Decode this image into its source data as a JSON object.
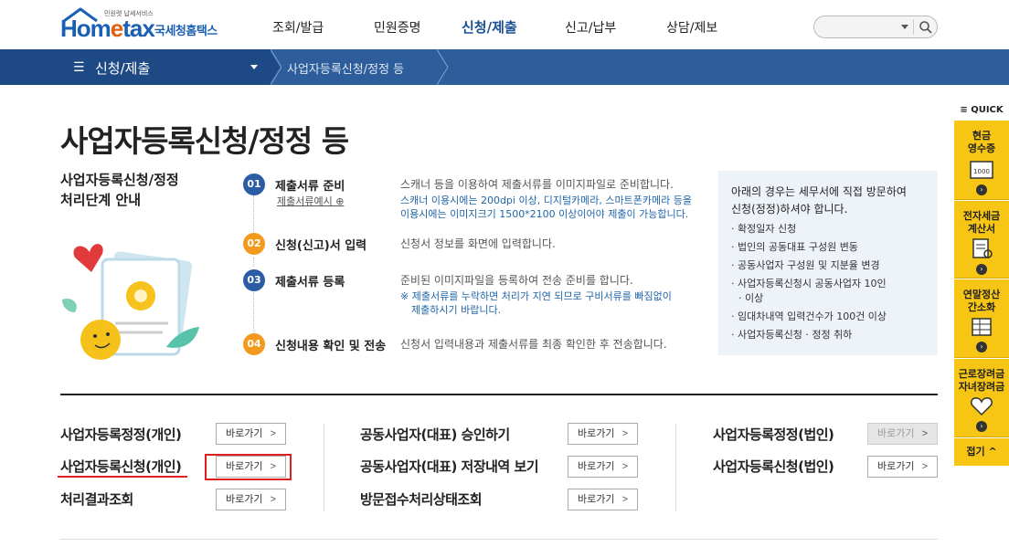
{
  "header": {
    "logo_en_1": "Hom",
    "logo_en_e": "e",
    "logo_en_2": "tax",
    "logo_small": "민원렛 납세서비스",
    "logo_ko": "국세청홈택스",
    "menu": [
      {
        "label": "조회/발급"
      },
      {
        "label": "민원증명"
      },
      {
        "label": "신청/제출",
        "active": true
      },
      {
        "label": "신고/납부"
      },
      {
        "label": "상담/제보"
      }
    ]
  },
  "navbar": {
    "current": "신청/제출",
    "breadcrumb": "사업자등록신청/정정 등"
  },
  "page": {
    "title": "사업자등록신청/정정 등",
    "guide_title_1": "사업자등록신청/정정",
    "guide_title_2": "처리단계 안내"
  },
  "steps": [
    {
      "num": "01",
      "title": "제출서류 준비",
      "sub": "제출서류예시",
      "desc": "스캐너 등을 이용하여 제출서류를 이미지파일로 준비합니다.",
      "note1": "스캐너 이용시에는 200dpi 이상, 디지털카메라, 스마트폰카메라 등을",
      "note2": "이용시에는 이미지크기 1500*2100 이상이어야 제출이 가능합니다."
    },
    {
      "num": "02",
      "title": "신청(신고)서 입력",
      "desc": "신청서 정보를 화면에 입력합니다."
    },
    {
      "num": "03",
      "title": "제출서류 등록",
      "desc": "준비된 이미지파일을 등록하여 전송 준비를 합니다.",
      "note1": "※ 제출서류를 누락하면 처리가 지연 되므로 구비서류를 빠짐없이",
      "note2": "제출하시기 바랍니다."
    },
    {
      "num": "04",
      "title": "신청내용 확인 및 전송",
      "desc": "신청서 입력내용과 제출서류를 최종 확인한 후 전송합니다."
    }
  ],
  "info": {
    "head1": "아래의 경우는 세무서에 직접 방문하여",
    "head2": "신청(정정)하셔야 합니다.",
    "items": [
      "확정일자 신청",
      "법인의 공동대표 구성원 변동",
      "공동사업자 구성원 및 지분율 변경",
      "사업자등록신청시 공동사업자 10인",
      "이상",
      "임대차내역 입력건수가 100건 이상",
      "사업자등록신청 · 정정 취하"
    ]
  },
  "services": {
    "go_label": "바로가기",
    "chev": ">",
    "col1": [
      "사업자등록정정(개인)",
      "사업자등록신청(개인)",
      "처리결과조회"
    ],
    "col2": [
      "공동사업자(대표) 승인하기",
      "공동사업자(대표) 저장내역 보기",
      "방문접수처리상태조회"
    ],
    "col3": [
      "사업자등록정정(법인)",
      "사업자등록신청(법인)"
    ]
  },
  "quick": {
    "head": "QUICK",
    "items": [
      {
        "line1": "현금",
        "line2": "영수증"
      },
      {
        "line1": "전자세금",
        "line2": "계산서"
      },
      {
        "line1": "연말정산",
        "line2": "간소화"
      },
      {
        "line1": "근로장려금",
        "line2": "자녀장려금"
      }
    ],
    "fold": "접기",
    "receipt_text": "1000"
  }
}
